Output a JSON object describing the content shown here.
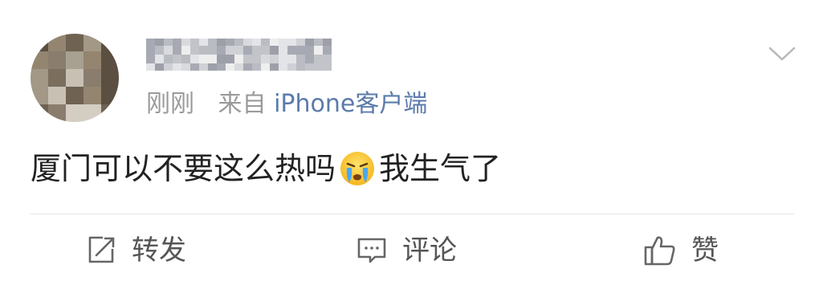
{
  "post": {
    "author": {
      "avatar_icon": "avatar-blurred",
      "name_icon": "username-blurred"
    },
    "meta": {
      "time": "刚刚",
      "source_prefix": "来自",
      "source_link": "iPhone客户端"
    },
    "text_part1": "厦门可以不要这么热吗",
    "emoji_icon": "crying-face-icon",
    "text_part2": "我生气了",
    "menu_icon": "chevron-down-icon"
  },
  "actions": {
    "repost": {
      "label": "转发",
      "icon": "repost-icon"
    },
    "comment": {
      "label": "评论",
      "icon": "comment-icon"
    },
    "like": {
      "label": "赞",
      "icon": "thumbs-up-icon"
    }
  },
  "colors": {
    "link": "#5b7bab",
    "meta": "#9a9a9a",
    "text": "#222222",
    "action": "#555555",
    "divider": "#e6e6e6"
  }
}
